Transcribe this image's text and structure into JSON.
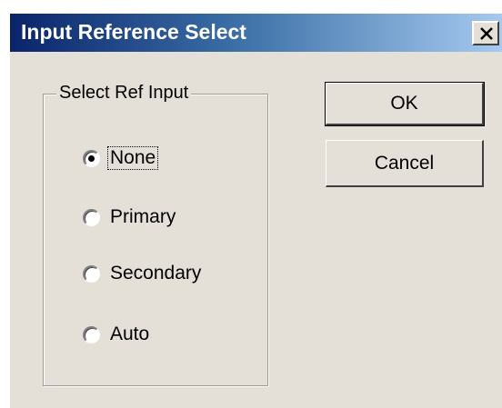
{
  "window": {
    "title": "Input Reference Select",
    "close_glyph": "×"
  },
  "group": {
    "label": "Select Ref Input",
    "options": [
      {
        "label": "None",
        "selected": true,
        "focused": true
      },
      {
        "label": "Primary",
        "selected": false
      },
      {
        "label": "Secondary",
        "selected": false
      },
      {
        "label": "Auto",
        "selected": false
      }
    ]
  },
  "buttons": {
    "ok_label": "OK",
    "cancel_label": "Cancel"
  },
  "colors": {
    "face": "#e4e0d8",
    "title_start": "#0a246a",
    "title_end": "#a6caf0"
  }
}
